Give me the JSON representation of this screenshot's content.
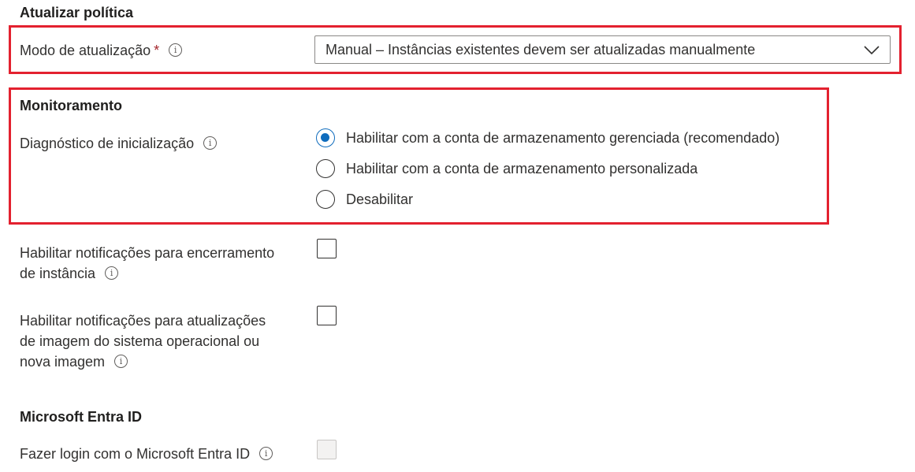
{
  "update_policy": {
    "title": "Atualizar política",
    "mode_label": "Modo de atualização",
    "required_mark": "*",
    "mode_value": "Manual – Instâncias existentes devem ser atualizadas manualmente"
  },
  "monitoring": {
    "title": "Monitoramento",
    "boot_diagnostics_label": "Diagnóstico de inicialização",
    "options": [
      {
        "label": "Habilitar com a conta de armazenamento gerenciada (recomendado)",
        "selected": true
      },
      {
        "label": "Habilitar com a conta de armazenamento personalizada",
        "selected": false
      },
      {
        "label": "Desabilitar",
        "selected": false
      }
    ]
  },
  "notifications": {
    "termination_label_line1": "Habilitar notificações para encerramento",
    "termination_label_line2": "de instância",
    "termination_checked": false,
    "os_upgrade_label_line1": "Habilitar notificações para atualizações",
    "os_upgrade_label_line2": "de imagem do sistema operacional ou",
    "os_upgrade_label_line3": "nova imagem",
    "os_upgrade_checked": false
  },
  "entra": {
    "title": "Microsoft Entra ID",
    "login_label": "Fazer login com o Microsoft Entra ID",
    "login_checked": false,
    "login_disabled": true
  },
  "icons": {
    "info": "info-icon",
    "chevron": "chevron-down-icon"
  },
  "colors": {
    "highlight": "#e3212f",
    "accent": "#0f6cbd",
    "required": "#a4262c"
  }
}
